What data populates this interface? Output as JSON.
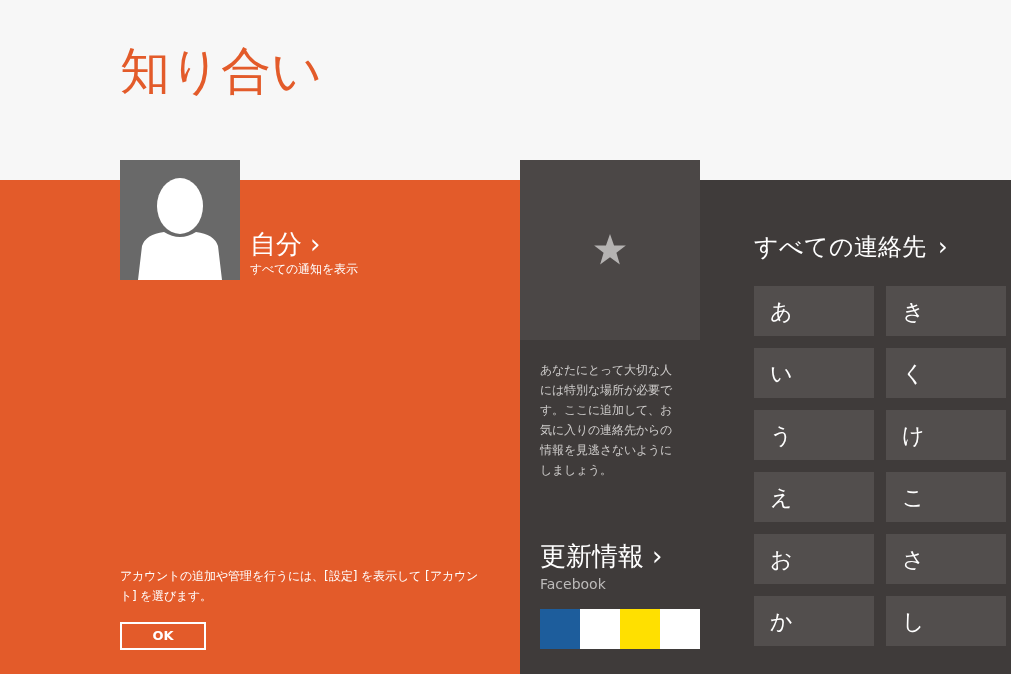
{
  "title": "知り合い",
  "me": {
    "name": "自分",
    "chevron": "›",
    "subtitle": "すべての通知を表示"
  },
  "account_note": "アカウントの追加や管理を行うには、[設定] を表示して [アカウント] を選びます。",
  "ok_button": "OK",
  "favorites": {
    "description": "あなたにとって大切な人には特別な場所が必要です。ここに追加して、お気に入りの連絡先からの情報を見逃さないようにしましょう。"
  },
  "updates": {
    "title": "更新情報",
    "chevron": "›",
    "source": "Facebook"
  },
  "all_contacts": {
    "title": "すべての連絡先",
    "chevron": "›",
    "letters": [
      "あ",
      "き",
      "い",
      "く",
      "う",
      "け",
      "え",
      "こ",
      "お",
      "さ",
      "か",
      "し"
    ]
  }
}
